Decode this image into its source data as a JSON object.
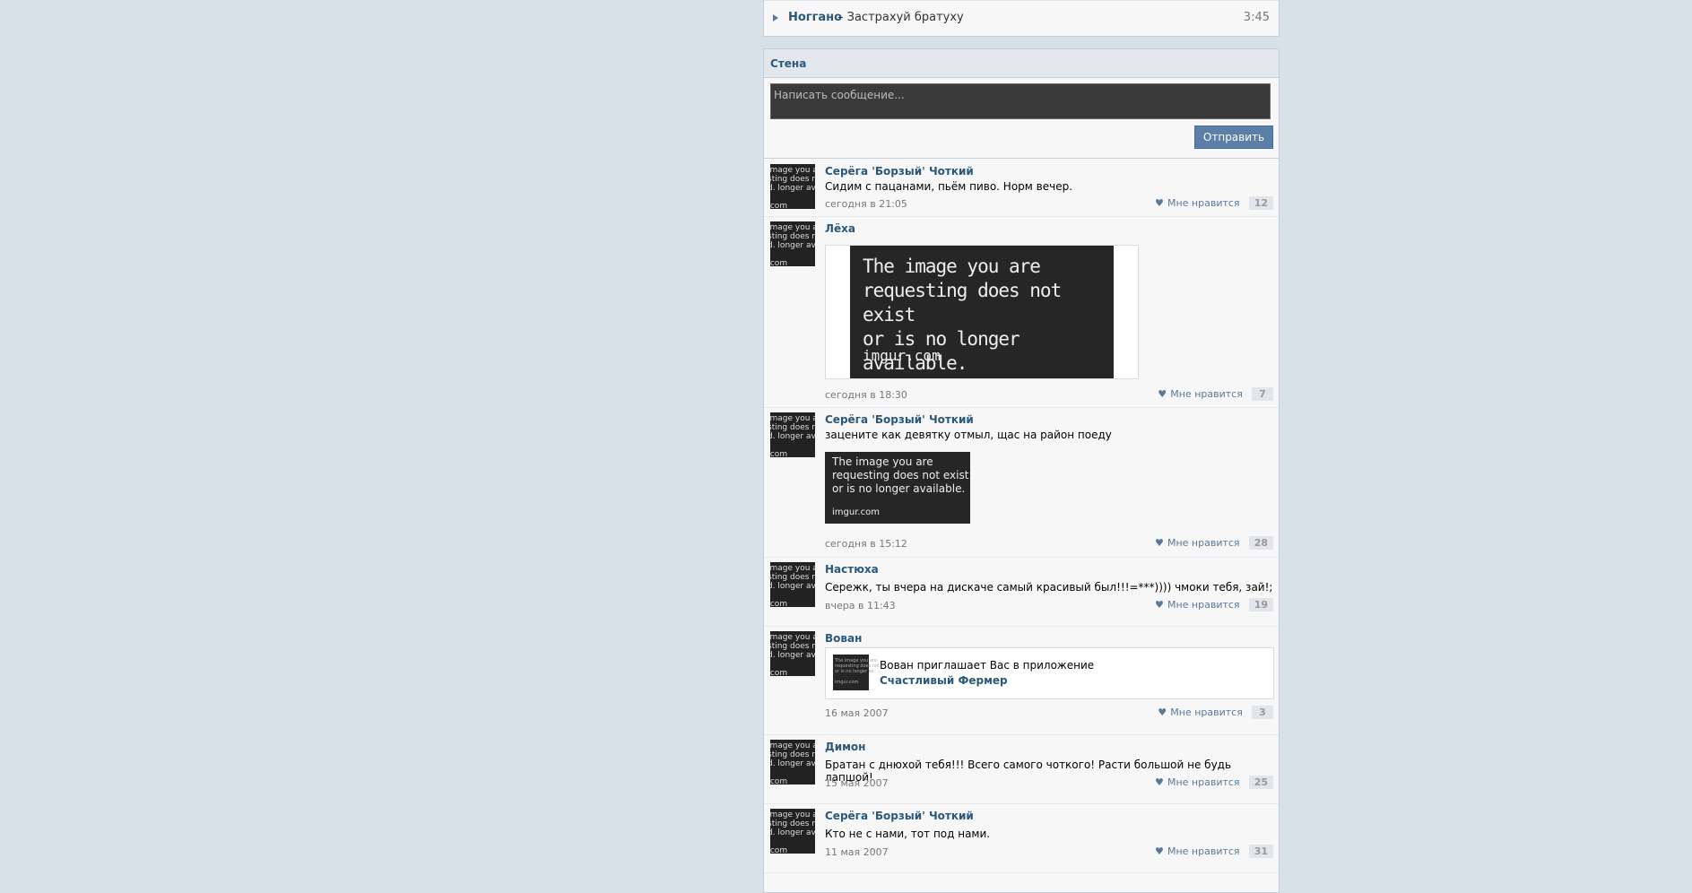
{
  "audio": {
    "artist": "Ноггано",
    "title": "– Застрахуй братуху",
    "duration": "3:45"
  },
  "wall": {
    "title": "Стена",
    "placeholder": "Написать сообщение...",
    "send_label": "Отправить",
    "like_label": "Мне нравится",
    "posts": [
      {
        "author": "Серёга 'Борзый' Чоткий",
        "text": "Сидим с пацанами, пьём пиво. Норм вечер.",
        "date": "сегодня в 21:05",
        "likes": "12"
      },
      {
        "author": "Лёха",
        "text": "",
        "date": "сегодня в 18:30",
        "likes": "7"
      },
      {
        "author": "Серёга 'Борзый' Чоткий",
        "text": "зацените как девятку отмыл, щас на район поеду",
        "date": "сегодня в 15:12",
        "likes": "28"
      },
      {
        "author": "Настюха",
        "text": "Сережк, ты вчера на дискаче самый красивый был!!!=***)))) чмоки тебя, зай!;",
        "date": "вчера в 11:43",
        "likes": "19"
      },
      {
        "author": "Вован",
        "text": "",
        "date": "16 мая 2007",
        "likes": "3",
        "app_text": "Вован приглашает Вас в приложение",
        "app_name": "Счастливый Фермер"
      },
      {
        "author": "Димон",
        "text": "Братан с днюхой тебя!!! Всего самого чоткого! Расти большой не будь лапшой!",
        "date": "15 мая 2007",
        "likes": "25"
      },
      {
        "author": "Серёга 'Борзый' Чоткий",
        "text": "Кто не с нами, тот под нами.",
        "date": "11 мая 2007",
        "likes": "31"
      }
    ]
  },
  "placeholder_image": {
    "line1": "The image you are",
    "line2": "requesting does not exist",
    "line3": "or is no longer available.",
    "domain": "imgur.com"
  },
  "colors": {
    "accent": "#2b587a",
    "button": "#5b7fa6",
    "background": "#d9e1e8"
  }
}
